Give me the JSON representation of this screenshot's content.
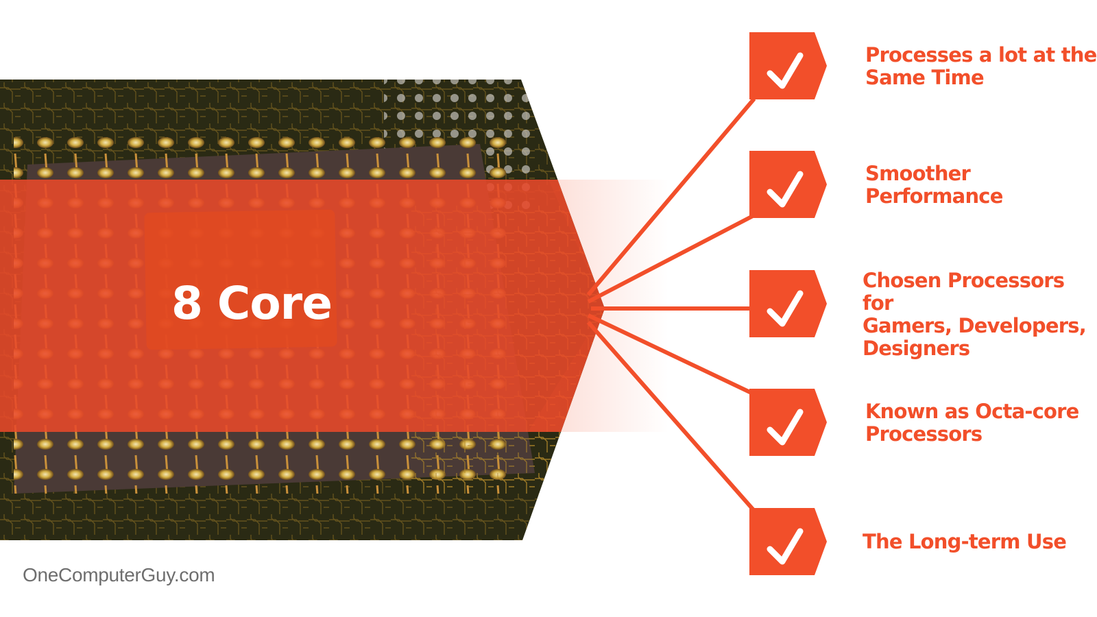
{
  "hero": {
    "label": "8 Core",
    "image": "cpu-circuit-board-photo"
  },
  "items": [
    {
      "lines": [
        "Processes a lot at the",
        "Same Time"
      ],
      "icon": "checkmark-icon"
    },
    {
      "lines": [
        "Smoother",
        "Performance"
      ],
      "icon": "checkmark-icon"
    },
    {
      "lines": [
        "Chosen Processors for",
        "Gamers, Developers,",
        "Designers"
      ],
      "icon": "checkmark-icon"
    },
    {
      "lines": [
        "Known as Octa-core",
        "Processors"
      ],
      "icon": "checkmark-icon"
    },
    {
      "lines": [
        "The Long-term Use"
      ],
      "icon": "checkmark-icon"
    }
  ],
  "watermark": "OneComputerGuy.com",
  "colors": {
    "accent": "#f24f2a",
    "band": "#e8492a",
    "text_white": "#ffffff",
    "watermark": "#6e6e6e"
  }
}
